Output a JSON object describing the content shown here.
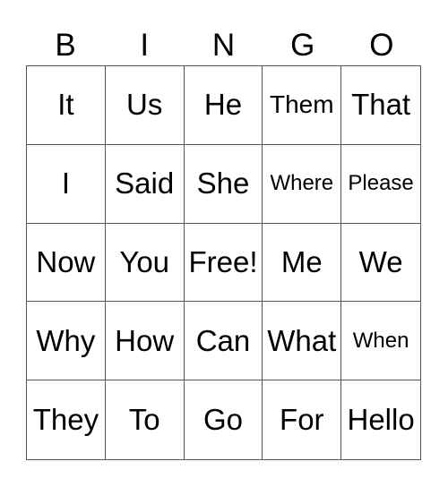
{
  "header": [
    "B",
    "I",
    "N",
    "G",
    "O"
  ],
  "cells": [
    [
      "It",
      "Us",
      "He",
      "Them",
      "That"
    ],
    [
      "I",
      "Said",
      "She",
      "Where",
      "Please"
    ],
    [
      "Now",
      "You",
      "Free!",
      "Me",
      "We"
    ],
    [
      "Why",
      "How",
      "Can",
      "What",
      "When"
    ],
    [
      "They",
      "To",
      "Go",
      "For",
      "Hello"
    ]
  ],
  "free_space": "Free!"
}
